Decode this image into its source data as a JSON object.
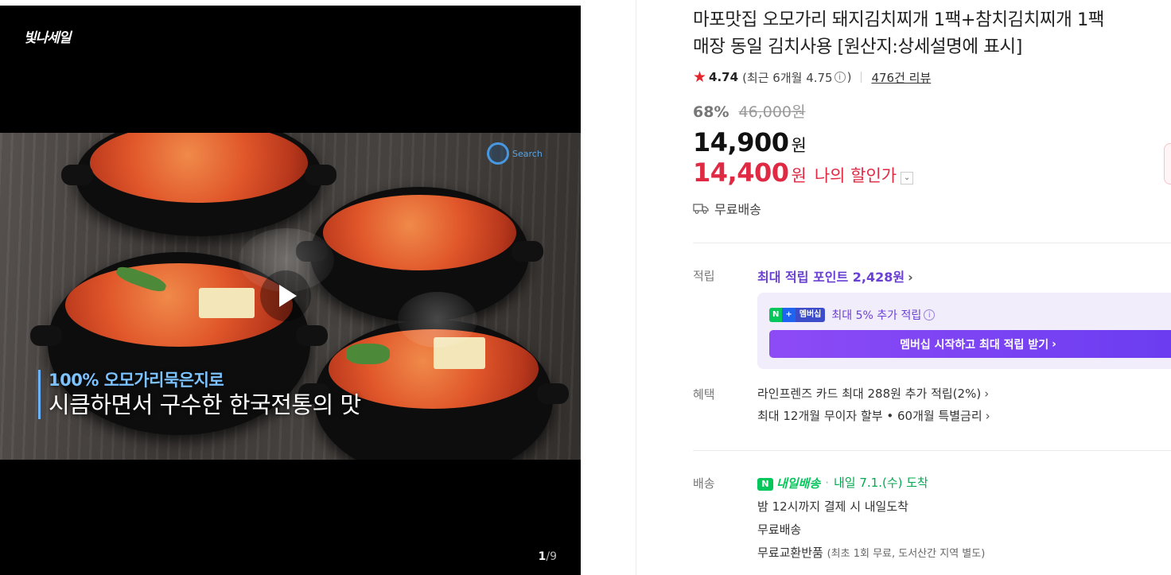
{
  "media": {
    "logo_text": "빛나세일",
    "watermark_text": "Search",
    "caption_line1": "100% 오모가리묵은지로",
    "caption_line2": "시큼하면서 구수한 한국전통의 맛",
    "counter_current": "1",
    "counter_separator": "/",
    "counter_total": "9",
    "play_icon": "play-icon"
  },
  "product": {
    "title_line1": "마포맛집 오모가리 돼지김치찌개 1팩+참치김치찌개 1팩",
    "title_line2": "매장 동일 김치사용 [원산지:상세설명에 표시]",
    "rating": "4.74",
    "recent_rating_prefix": "(최근 6개월 4.75",
    "recent_rating_suffix": ")",
    "review_count": "476건 리뷰",
    "discount_pct": "68%",
    "original_price": "46,000원",
    "price_num": "14,900",
    "price_unit": "원",
    "my_price_num": "14,400",
    "my_price_unit": "원",
    "my_price_label": "나의 할인가",
    "shipping": "무료배송"
  },
  "points": {
    "label": "적립",
    "max_points": "최대 적립 포인트 2,428원",
    "badge_n": "N",
    "badge_plus": "+",
    "badge_member": "멤버십",
    "extra": "최대 5% 추가 적립",
    "cta": "멤버십 시작하고 최대 적립 받기"
  },
  "benefits": {
    "label": "혜택",
    "card": "라인프렌즈 카드 최대 288원 추가 적립(2%)",
    "installment": "최대 12개월 무이자 할부 • 60개월 특별금리"
  },
  "delivery": {
    "label": "배송",
    "badge_n": "N",
    "badge_text": "내일배송",
    "arrival": "내일 7.1.(수) 도착",
    "cutoff": "밤 12시까지 결제 시 내일도착",
    "free": "무료배송",
    "return_main": "무료교환반품",
    "return_note": "(최초 1회 무료, 도서산간 지역 별도)"
  },
  "colors": {
    "accent_purple": "#6a3fd4",
    "price_red": "#e02a44",
    "naver_green": "#03c75a",
    "star_red": "#e1262b"
  }
}
